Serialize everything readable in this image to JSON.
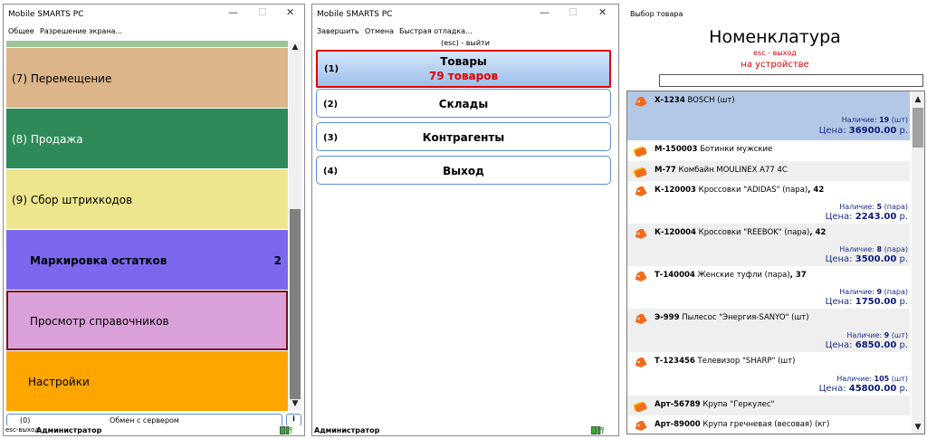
{
  "win1": {
    "title": "Mobile SMARTS PC",
    "menu": [
      "Общее",
      "Разрешение экрана..."
    ],
    "tiles": [
      {
        "label": "(7) Перемещение",
        "color": "#dcb58a"
      },
      {
        "label": "(8) Продажа",
        "color": "#2f8a5a"
      },
      {
        "label": "(9) Сбор штрихкодов",
        "color": "#eee58f"
      },
      {
        "label": "Маркировка остатков",
        "badge": "2",
        "color": "#7b68ee"
      },
      {
        "label": "Просмотр справочников",
        "color": "#d9a0d9"
      },
      {
        "label": "Настройки",
        "color": "#ffa500"
      }
    ],
    "bottom": {
      "num": "(0)",
      "label": "Обмен с сервером",
      "info": "i"
    },
    "status": {
      "left": "esc-выход",
      "user": "Администратор"
    }
  },
  "win2": {
    "title": "Mobile SMARTS PC",
    "menu": [
      "Завершить",
      "Отмена",
      "Быстрая отладка..."
    ],
    "hint": "(esc) - выйти",
    "buttons": [
      {
        "num": "(1)",
        "label": "Товары",
        "sub": "79 товаров"
      },
      {
        "num": "(2)",
        "label": "Склады"
      },
      {
        "num": "(3)",
        "label": "Контрагенты"
      },
      {
        "num": "(4)",
        "label": "Выход"
      }
    ],
    "status": {
      "user": "Администратор"
    }
  },
  "win3": {
    "title": "Выбор товара",
    "heading": "Номенклатура",
    "esc": "esc - выход",
    "device": "на устройстве",
    "search_value": "",
    "items": [
      {
        "code": "Х-1234",
        "name": "BOSCH (шт)",
        "stock_label": "Наличие:",
        "stock": "19",
        "unit": "(шт)",
        "price_label": "Цена:",
        "price": "36900.00",
        "cur": "р.",
        "icon": "tag"
      },
      {
        "code": "М-150003",
        "name": "Ботинки мужские",
        "icon": "tags"
      },
      {
        "code": "М-77",
        "name": "Комбайн MOULINEX A77 4C",
        "icon": "tags"
      },
      {
        "code": "К-120003",
        "name": "Кроссовки \"ADIDAS\" (пара)",
        "size": ", 42",
        "stock_label": "Наличие:",
        "stock": "5",
        "unit": "(пара)",
        "price_label": "Цена:",
        "price": "2243.00",
        "cur": "р.",
        "icon": "tag"
      },
      {
        "code": "К-120004",
        "name": "Кроссовки \"REEBOK\" (пара)",
        "size": ", 42",
        "stock_label": "Наличие:",
        "stock": "8",
        "unit": "(пара)",
        "price_label": "Цена:",
        "price": "3500.00",
        "cur": "р.",
        "icon": "tag"
      },
      {
        "code": "Т-140004",
        "name": "Женские туфли (пара)",
        "size": ", 37",
        "stock_label": "Наличие:",
        "stock": "9",
        "unit": "(пара)",
        "price_label": "Цена:",
        "price": "1750.00",
        "cur": "р.",
        "icon": "tag"
      },
      {
        "code": "Э-999",
        "name": "Пылесос \"Энергия-SANYO\" (шт)",
        "stock_label": "Наличие:",
        "stock": "9",
        "unit": "(шт)",
        "price_label": "Цена:",
        "price": "6850.00",
        "cur": "р.",
        "icon": "tag"
      },
      {
        "code": "Т-123456",
        "name": "Телевизор \"SHARP\" (шт)",
        "stock_label": "Наличие:",
        "stock": "105",
        "unit": "(шт)",
        "price_label": "Цена:",
        "price": "45800.00",
        "cur": "р.",
        "icon": "tag"
      },
      {
        "code": "Арт-56789",
        "name": "Крупа \"Геркулес\"",
        "icon": "tags"
      },
      {
        "code": "Арт-89000",
        "name": "Крупа гречневая (весовая) (кг)",
        "icon": "tag"
      }
    ]
  },
  "colors": {
    "accent_blue": "#5b8fd6",
    "selected_row": "#b3c8e6",
    "alt_row": "#efefef",
    "red": "#e00000",
    "price_blue": "#1a2e8a",
    "tag_orange": "#f36b1c"
  }
}
